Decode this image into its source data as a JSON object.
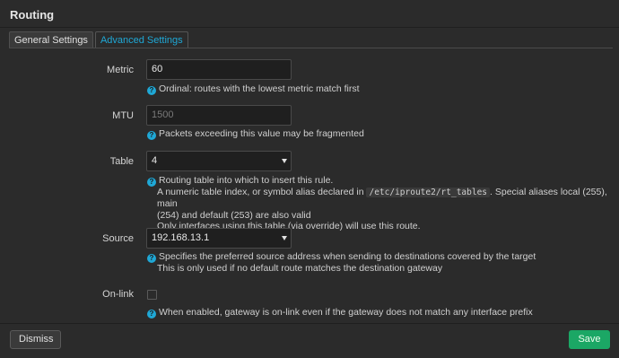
{
  "dialog": {
    "title": "Routing",
    "tabs": [
      {
        "label": "General Settings"
      },
      {
        "label": "Advanced Settings"
      }
    ]
  },
  "fields": {
    "metric": {
      "label": "Metric",
      "value": "60",
      "help": "Ordinal: routes with the lowest metric match first"
    },
    "mtu": {
      "label": "MTU",
      "placeholder": "1500",
      "help": "Packets exceeding this value may be fragmented"
    },
    "table": {
      "label": "Table",
      "value": "4",
      "help_line1": "Routing table into which to insert this rule.",
      "help_line2_pre": "A numeric table index, or symbol alias declared in",
      "help_code": "/etc/iproute2/rt_tables",
      "help_line2_post": ". Special aliases local (255), main",
      "help_line3": "(254) and default (253) are also valid",
      "help_line4": "Only interfaces using this table (via override) will use this route."
    },
    "source": {
      "label": "Source",
      "value": "192.168.13.1",
      "help_line1": "Specifies the preferred source address when sending to destinations covered by the target",
      "help_line2": "This is only used if no default route matches the destination gateway"
    },
    "onlink": {
      "label": "On-link",
      "checked": false,
      "help": "When enabled, gateway is on-link even if the gateway does not match any interface prefix"
    }
  },
  "footer": {
    "dismiss_label": "Dismiss",
    "save_label": "Save"
  },
  "colors": {
    "accent": "#1fa8d6",
    "save": "#1ba765",
    "background": "#2b2b2b"
  }
}
